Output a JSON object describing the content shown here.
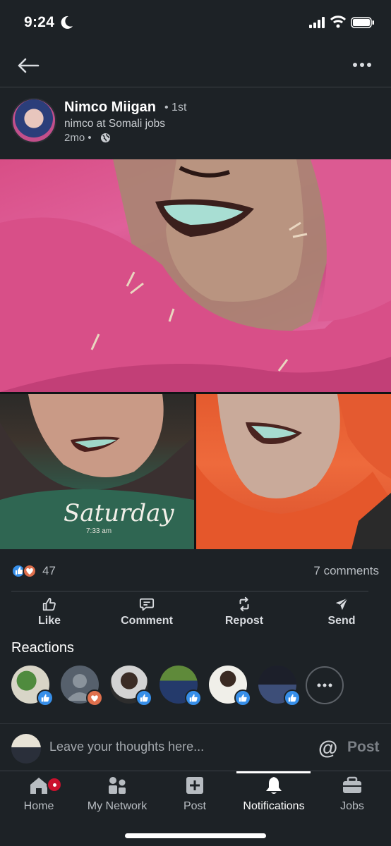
{
  "status_bar": {
    "time": "9:24"
  },
  "post": {
    "author_name": "Nimco Miigan",
    "degree": "• 1st",
    "headline": "nimco at Somali jobs",
    "time": "2mo •"
  },
  "collage": {
    "caption": "Saturday",
    "caption_time": "7:33 am"
  },
  "social": {
    "reaction_count": "47",
    "comments": "7 comments"
  },
  "actions": [
    {
      "label": "Like",
      "icon": "like-icon"
    },
    {
      "label": "Comment",
      "icon": "comment-icon"
    },
    {
      "label": "Repost",
      "icon": "repost-icon"
    },
    {
      "label": "Send",
      "icon": "send-icon"
    }
  ],
  "reactions": {
    "title": "Reactions",
    "people": [
      {
        "reaction": "like",
        "color": "#378fe9"
      },
      {
        "reaction": "love",
        "color": "#df704d"
      },
      {
        "reaction": "like",
        "color": "#378fe9"
      },
      {
        "reaction": "like",
        "color": "#378fe9"
      },
      {
        "reaction": "like",
        "color": "#378fe9"
      },
      {
        "reaction": "like",
        "color": "#378fe9"
      }
    ]
  },
  "comment_bar": {
    "placeholder": "Leave your thoughts here...",
    "at_symbol": "@",
    "post_label": "Post"
  },
  "tabs": [
    {
      "label": "Home",
      "icon": "home-icon"
    },
    {
      "label": "My Network",
      "icon": "network-icon"
    },
    {
      "label": "Post",
      "icon": "add-post-icon"
    },
    {
      "label": "Notifications",
      "icon": "bell-icon",
      "active": true
    },
    {
      "label": "Jobs",
      "icon": "briefcase-icon"
    }
  ],
  "colors": {
    "background": "#1d2226",
    "like_blue": "#378fe9",
    "love_orange": "#df704d",
    "notification_red": "#cb112d"
  }
}
